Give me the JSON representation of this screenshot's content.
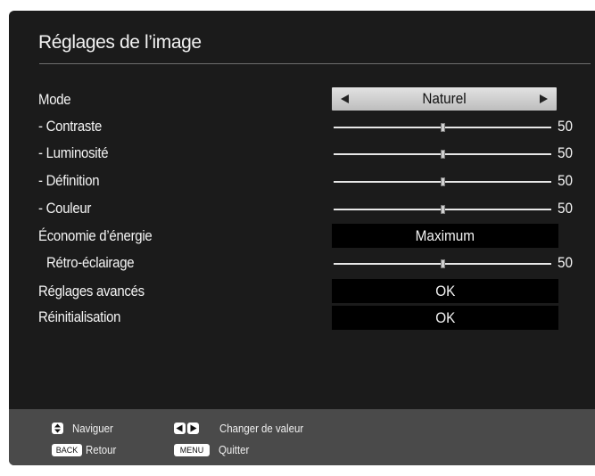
{
  "menu": {
    "title": "Réglages de l’image"
  },
  "rows": [
    {
      "label": "Mode",
      "value": "Naturel"
    },
    {
      "label": "- Contraste",
      "value": "50",
      "level": 0.5
    },
    {
      "label": "- Luminosité",
      "value": "50",
      "level": 0.5
    },
    {
      "label": "- Définition",
      "value": "50",
      "level": 0.5
    },
    {
      "label": "- Couleur",
      "value": "50",
      "level": 0.5
    },
    {
      "label": "Économie d’énergie",
      "value": "Maximum"
    },
    {
      "label": "Rétro-éclairage",
      "value": "50",
      "level": 0.5
    },
    {
      "label": "Réglages avancés",
      "value": "OK"
    },
    {
      "label": "Réinitialisation",
      "value": "OK"
    }
  ],
  "footer": {
    "navigate_label": "Naviguer",
    "change_label": "Changer de valeur",
    "back_key": "BACK",
    "back_label": "Retour",
    "menu_key": "MENU",
    "menu_label": "Quitter"
  },
  "icons": {
    "mode_prev": "arrow-left-icon",
    "mode_next": "arrow-right-icon",
    "navigate": "up-down-icon",
    "change": "left-right-icon"
  },
  "colors": {
    "panel": "#1b1b1b",
    "footer": "#4a4a4a",
    "selected": "#c8c8c8",
    "text": "#f4f4f4"
  }
}
